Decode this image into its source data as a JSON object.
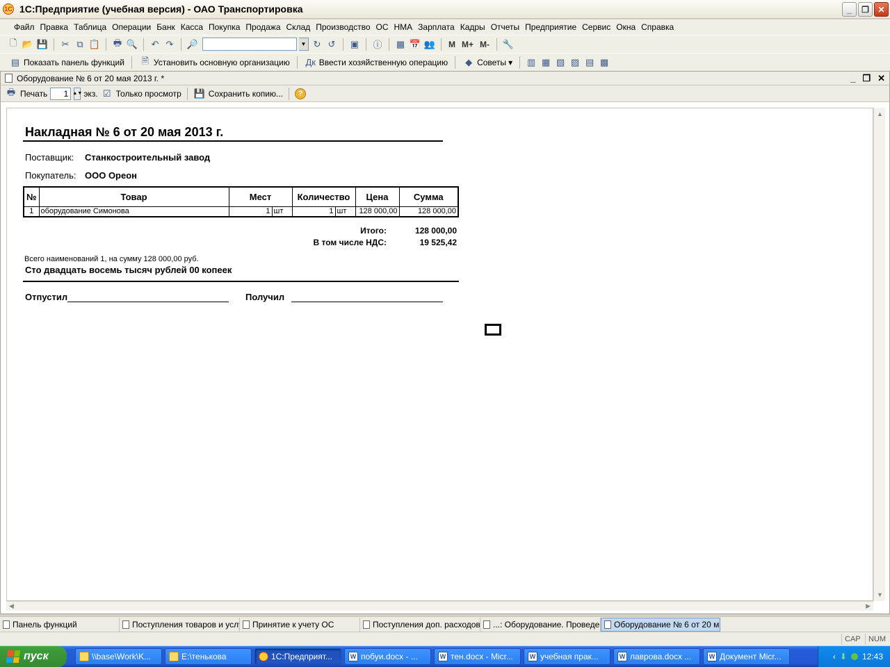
{
  "window": {
    "title": "1С:Предприятие (учебная версия) - ОАО Транспортировка",
    "logo_text": "1С"
  },
  "menu": [
    "Файл",
    "Правка",
    "Таблица",
    "Операции",
    "Банк",
    "Касса",
    "Покупка",
    "Продажа",
    "Склад",
    "Производство",
    "ОС",
    "НМА",
    "Зарплата",
    "Кадры",
    "Отчеты",
    "Предприятие",
    "Сервис",
    "Окна",
    "Справка"
  ],
  "toolbar2": {
    "show_panel": "Показать панель функций",
    "set_org": "Установить основную организацию",
    "enter_op": "Ввести хозяйственную операцию",
    "tips": "Советы"
  },
  "mem_buttons": [
    "M",
    "M+",
    "M-"
  ],
  "document": {
    "title": "Оборудование № 6 от 20 мая 2013 г. *",
    "print": "Печать",
    "copies": "1",
    "copies_unit": "экз.",
    "view_only": "Только просмотр",
    "save_copy": "Сохранить копию...",
    "help": "?"
  },
  "invoice": {
    "title": "Накладная № 6 от 20 мая 2013 г.",
    "supplier_label": "Поставщик:",
    "supplier": "Станкостроительный завод",
    "buyer_label": "Покупатель:",
    "buyer": "ООО Ореон",
    "columns": [
      "№",
      "Товар",
      "Мест",
      "Количество",
      "Цена",
      "Сумма"
    ],
    "row": {
      "num": "1",
      "item": "оборудование Симонова",
      "places": "1",
      "places_unit": "шт",
      "qty": "1",
      "qty_unit": "шт",
      "price": "128 000,00",
      "sum": "128 000,00"
    },
    "total_label": "Итого:",
    "total": "128 000,00",
    "vat_label": "В том числе НДС:",
    "vat": "19 525,42",
    "summary": "Всего наименований 1, на сумму 128 000,00 руб.",
    "amount_words": "Сто двадцать восемь тысяч рублей 00 копеек",
    "released_label": "Отпустил",
    "received_label": "Получил"
  },
  "window_tabs": [
    "Панель функций",
    "Поступления товаров и услуг",
    "Принятие к учету ОС",
    "Поступления доп. расходов",
    "...: Оборудование. Проведен",
    "Оборудование № 6 от 20 м..."
  ],
  "status": {
    "cap": "CAP",
    "num": "NUM"
  },
  "taskbar": {
    "start": "пуск",
    "tasks": [
      "\\\\base\\Work\\K...",
      "E:\\тенькова",
      "1С:Предприят...",
      "побуи.docx - ...",
      "тен.docx - Micr...",
      "учебная прак...",
      "лаврова.docx ...",
      "Документ Micr..."
    ],
    "clock": "12:43"
  }
}
